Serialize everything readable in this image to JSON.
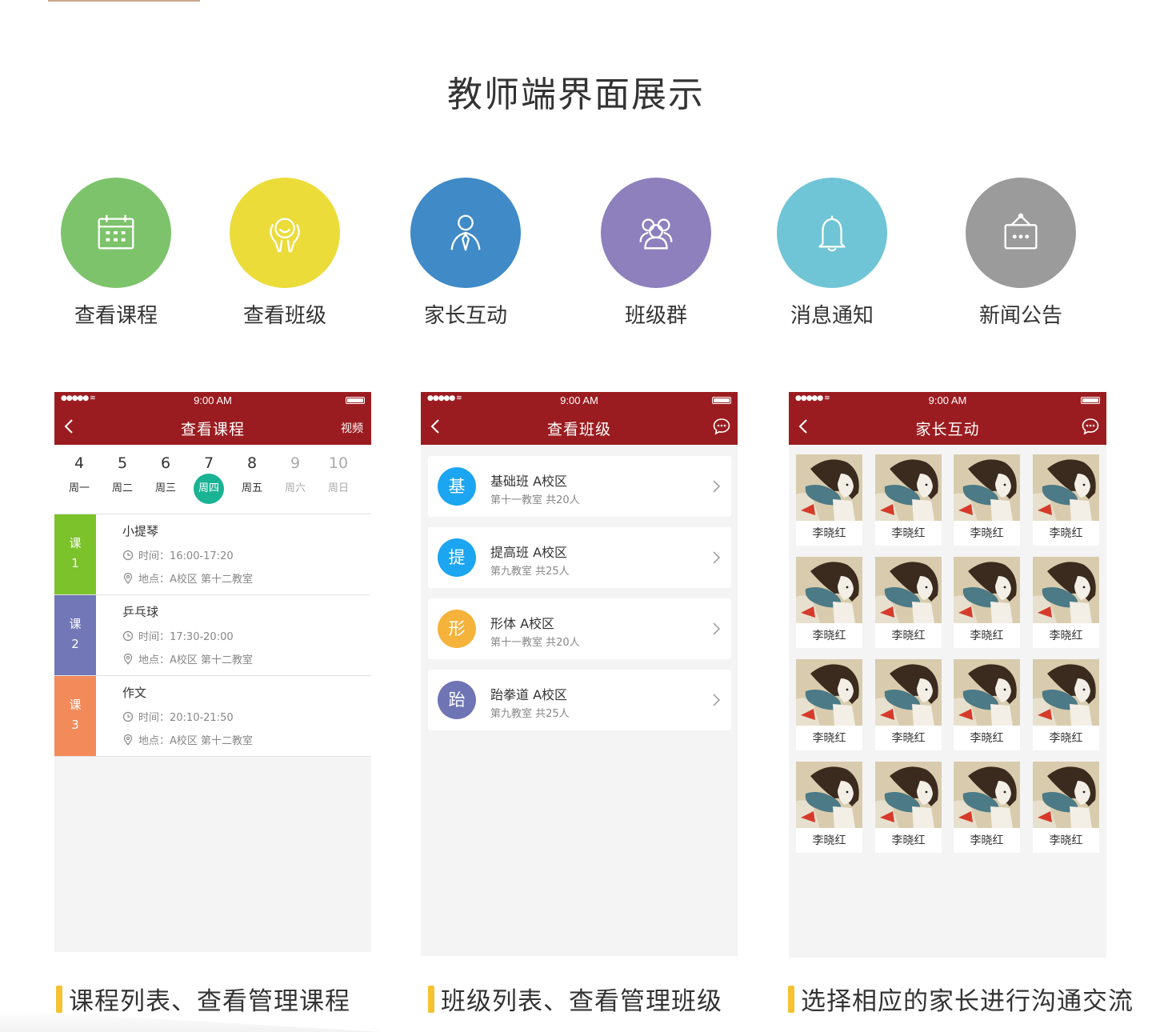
{
  "page": {
    "title": "教师端界面展示"
  },
  "features": [
    {
      "label": "查看课程",
      "icon": "calendar-icon",
      "color": "#7dc36b"
    },
    {
      "label": "查看班级",
      "icon": "group-hands-icon",
      "color": "#ecdc3a"
    },
    {
      "label": "家长互动",
      "icon": "person-tie-icon",
      "color": "#3f8ac7"
    },
    {
      "label": "班级群",
      "icon": "people-group-icon",
      "color": "#8d80bd"
    },
    {
      "label": "消息通知",
      "icon": "bell-icon",
      "color": "#6fc5d6"
    },
    {
      "label": "新闻公告",
      "icon": "notice-board-icon",
      "color": "#9b9b9b"
    }
  ],
  "status": {
    "time": "9:00 AM"
  },
  "screen1": {
    "title": "查看课程",
    "right_label": "视频",
    "week": [
      {
        "num": "4",
        "name": "周一"
      },
      {
        "num": "5",
        "name": "周二"
      },
      {
        "num": "6",
        "name": "周三"
      },
      {
        "num": "7",
        "name": "周四"
      },
      {
        "num": "8",
        "name": "周五"
      },
      {
        "num": "9",
        "name": "周六"
      },
      {
        "num": "10",
        "name": "周日"
      }
    ],
    "courses": [
      {
        "tag": "课",
        "num": "1",
        "name": "小提琴",
        "time": "时间：16:00-17:20",
        "location": "地点：A校区 第十二教室",
        "color": "#7cc22b"
      },
      {
        "tag": "课",
        "num": "2",
        "name": "乒乓球",
        "time": "时间：17:30-20:00",
        "location": "地点：A校区 第十二教室",
        "color": "#7277b7"
      },
      {
        "tag": "课",
        "num": "3",
        "name": "作文",
        "time": "时间：20:10-21:50",
        "location": "地点：A校区 第十二教室",
        "color": "#f38a5a"
      }
    ]
  },
  "screen2": {
    "title": "查看班级",
    "classes": [
      {
        "avatar": "基",
        "name": "基础班   A校区",
        "meta": "第十一教室    共20人",
        "color": "#1ca5f0"
      },
      {
        "avatar": "提",
        "name": "提高班   A校区",
        "meta": "第九教室    共25人",
        "color": "#1ca5f0"
      },
      {
        "avatar": "形",
        "name": "形体   A校区",
        "meta": "第十一教室    共20人",
        "color": "#f5b33b"
      },
      {
        "avatar": "跆",
        "name": "跆拳道   A校区",
        "meta": "第九教室    共25人",
        "color": "#6f74b5"
      }
    ]
  },
  "screen3": {
    "title": "家长互动",
    "contacts": [
      "李晓红",
      "李晓红",
      "李晓红",
      "李晓红",
      "李晓红",
      "李晓红",
      "李晓红",
      "李晓红",
      "李晓红",
      "李晓红",
      "李晓红",
      "李晓红",
      "李晓红",
      "李晓红",
      "李晓红",
      "李晓红"
    ]
  },
  "captions": [
    "课程列表、查看管理课程",
    "班级列表、查看管理班级",
    "选择相应的家长进行沟通交流"
  ],
  "colors": {
    "navbar": "#9b1c20",
    "accent_bar": "#f5c231",
    "active_day": "#1ab394"
  }
}
